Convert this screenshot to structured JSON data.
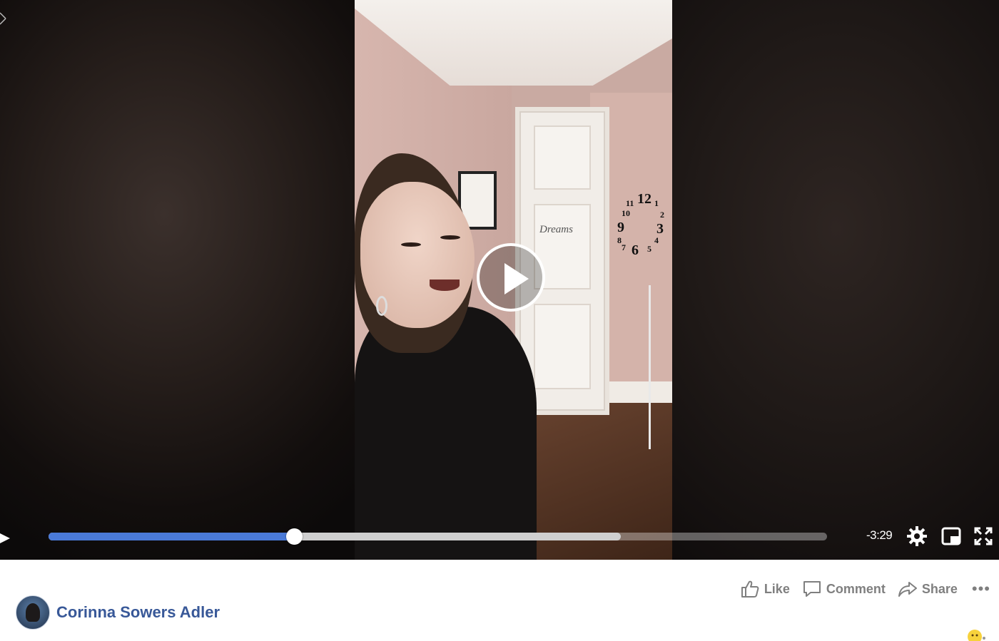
{
  "video": {
    "time_remaining": "-3:29",
    "progress_played": 0.315,
    "progress_buffered": 0.735
  },
  "scene": {
    "door_sign": "Dreams"
  },
  "clock_numbers": [
    "12",
    "1",
    "2",
    "3",
    "4",
    "5",
    "6",
    "7",
    "8",
    "9",
    "10",
    "11"
  ],
  "actions": {
    "like": "Like",
    "comment": "Comment",
    "share": "Share",
    "more": "•••"
  },
  "author": {
    "name": "Corinna Sowers Adler"
  },
  "colors": {
    "progress": "#4a7ad8",
    "link": "#385898",
    "action_gray": "#7f7f7f"
  },
  "icons": [
    "play-icon",
    "settings-gear-icon",
    "mini-player-icon",
    "fullscreen-icon",
    "like-thumb-icon",
    "comment-bubble-icon",
    "share-arrow-icon",
    "more-dots-icon"
  ]
}
